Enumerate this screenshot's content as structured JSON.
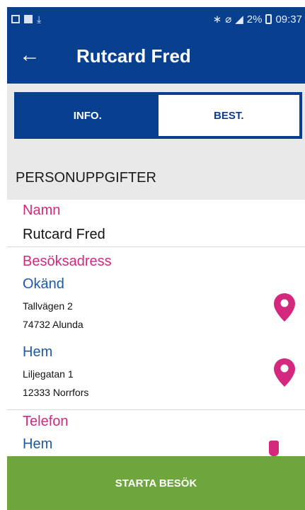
{
  "status_bar": {
    "battery_text": "2%",
    "time": "09:37"
  },
  "app_bar": {
    "back_icon": "arrow-left-icon",
    "title": "Rutcard Fred"
  },
  "tabs": [
    {
      "label": "INFO.",
      "active": false
    },
    {
      "label": "BEST.",
      "active": true
    }
  ],
  "section": {
    "title": "PERSONUPPGIFTER"
  },
  "person": {
    "name_label": "Namn",
    "name_value": "Rutcard Fred",
    "visit_address_label": "Besöksadress",
    "addresses": [
      {
        "type": "Okänd",
        "street": "Tallvägen 2",
        "postal": "74732 Alunda"
      },
      {
        "type": "Hem",
        "street": "Liljegatan 1",
        "postal": "12333 Norrfors"
      }
    ],
    "phone_label": "Telefon",
    "phone_type": "Hem"
  },
  "action_button": {
    "label": "STARTA BESÖK"
  },
  "colors": {
    "primary": "#083f8f",
    "accent": "#d4287e",
    "button": "#6ea53d"
  }
}
